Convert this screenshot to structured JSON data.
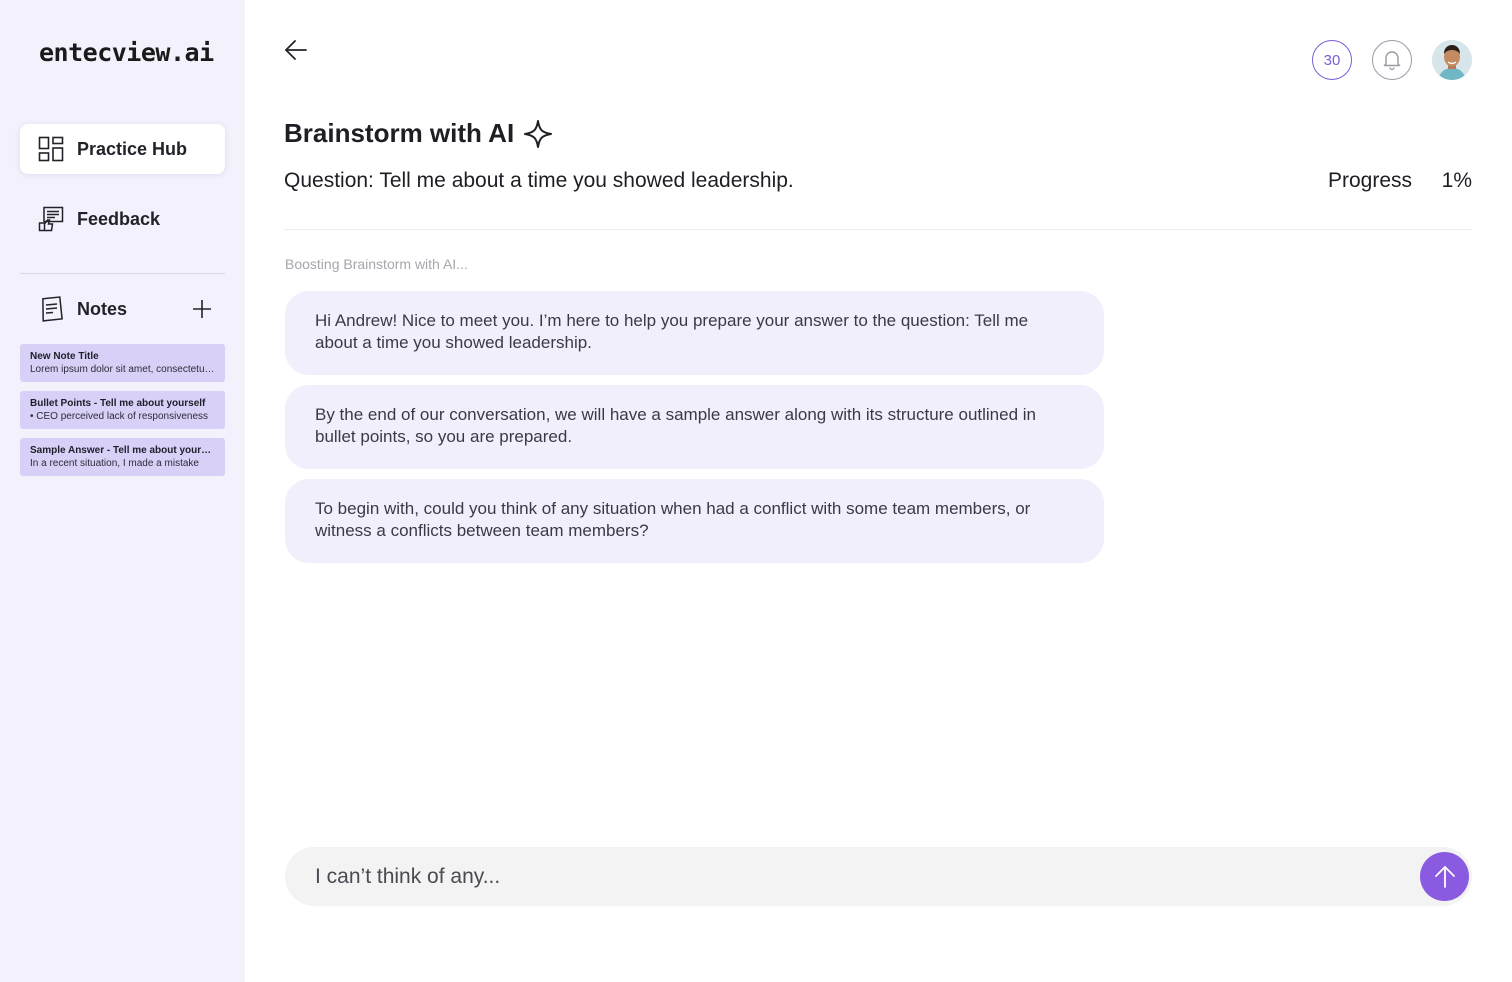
{
  "brand": {
    "logo_text": "entecview.ai"
  },
  "sidebar": {
    "nav": [
      {
        "label": "Practice Hub",
        "icon": "grid-icon",
        "active": true
      },
      {
        "label": "Feedback",
        "icon": "feedback-icon",
        "active": false
      }
    ],
    "notes": {
      "label": "Notes",
      "items": [
        {
          "title": "New Note Title",
          "body": "Lorem ipsum dolor sit amet, consectetur adipiscing elit"
        },
        {
          "title": "Bullet Points - Tell me about yourself",
          "body": "•  CEO perceived lack of responsiveness"
        },
        {
          "title": "Sample Answer - Tell me about yourself",
          "body": "In a recent situation, I made a mistake"
        }
      ]
    }
  },
  "header": {
    "credits": "30"
  },
  "main": {
    "title": "Brainstorm with AI",
    "question": "Question: Tell me about a time you showed leadership.",
    "progress_label": "Progress",
    "progress_value": "1%",
    "status": "Boosting Brainstorm with AI...",
    "messages": [
      "Hi Andrew! Nice to meet you. I’m here to help you prepare your answer to the question: Tell me about a time you showed leadership.",
      "By the end of our conversation, we will have a sample answer along with its structure outlined in bullet points, so you are prepared.",
      "To begin with, could you think of any situation when had a conflict with some team members, or witness a conflicts between team members?"
    ]
  },
  "composer": {
    "value": "I can’t think of any..."
  },
  "colors": {
    "accent": "#8a5ae0",
    "sidebar_bg": "#f3f1fc",
    "bubble_bg": "#f1effc",
    "note_bg": "#d8d0f6"
  }
}
